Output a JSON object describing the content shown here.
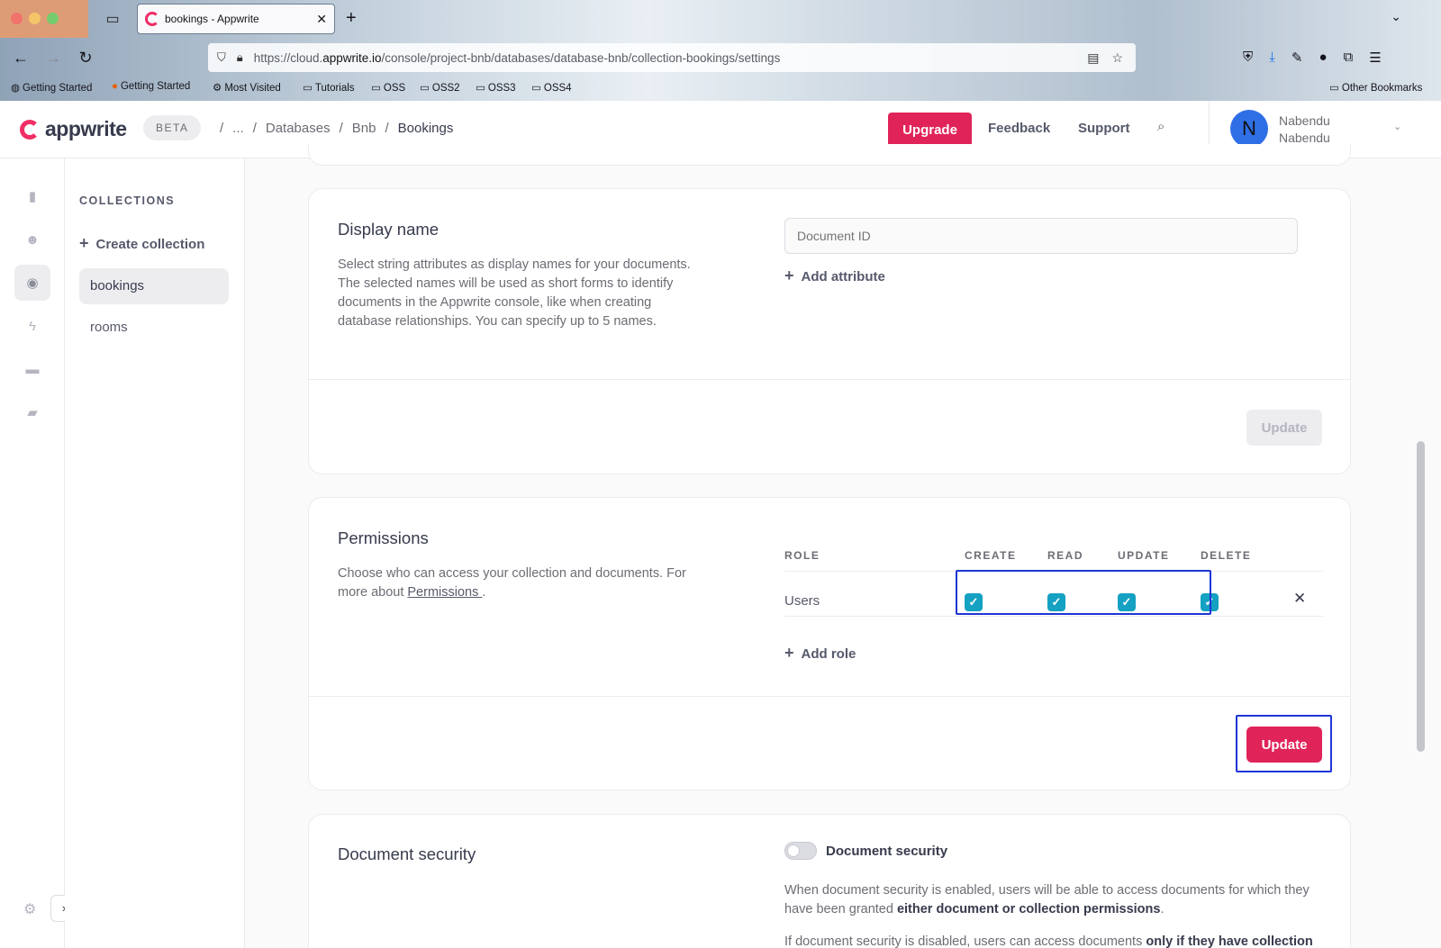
{
  "browser": {
    "tab_title": "bookings - Appwrite",
    "url_prefix": "https://cloud.",
    "url_domain": "appwrite.io",
    "url_path": "/console/project-bnb/databases/database-bnb/collection-bookings/settings",
    "bookmarks": [
      "Getting Started",
      "Getting Started",
      "Most Visited",
      "Tutorials",
      "OSS",
      "OSS2",
      "OSS3",
      "OSS4"
    ],
    "other_bookmarks": "Other Bookmarks"
  },
  "header": {
    "logo_text": "appwrite",
    "beta": "BETA",
    "breadcrumbs": [
      "...",
      "Databases",
      "Bnb",
      "Bookings"
    ],
    "upgrade": "Upgrade",
    "feedback": "Feedback",
    "support": "Support",
    "avatar_initial": "N",
    "user_name_line1": "Nabendu",
    "user_name_line2": "Nabendu"
  },
  "sidebar": {
    "heading": "COLLECTIONS",
    "create": "Create collection",
    "items": [
      "bookings",
      "rooms"
    ]
  },
  "display_name": {
    "title": "Display name",
    "description": "Select string attributes as display names for your documents. The selected names will be used as short forms to identify documents in the Appwrite console, like when creating database relationships. You can specify up to 5 names.",
    "input_placeholder": "Document ID",
    "add_attribute": "Add attribute",
    "update": "Update"
  },
  "permissions": {
    "title": "Permissions",
    "description_prefix": "Choose who can access your collection and documents. For more about ",
    "description_link": "Permissions ",
    "description_suffix": ".",
    "columns": [
      "ROLE",
      "CREATE",
      "READ",
      "UPDATE",
      "DELETE"
    ],
    "row_role": "Users",
    "add_role": "Add role",
    "update": "Update"
  },
  "document_security": {
    "title": "Document security",
    "toggle_label": "Document security",
    "p1_prefix": "When document security is enabled, users will be able to access documents for which they have been granted ",
    "p1_bold": "either document or collection permissions",
    "p1_suffix": ".",
    "p2_prefix": "If document security is disabled, users can access documents ",
    "p2_bold": "only if they have collection"
  },
  "colors": {
    "accent": "#e0245a",
    "checkbox": "#14a1c2",
    "highlight": "#1f35d6"
  }
}
